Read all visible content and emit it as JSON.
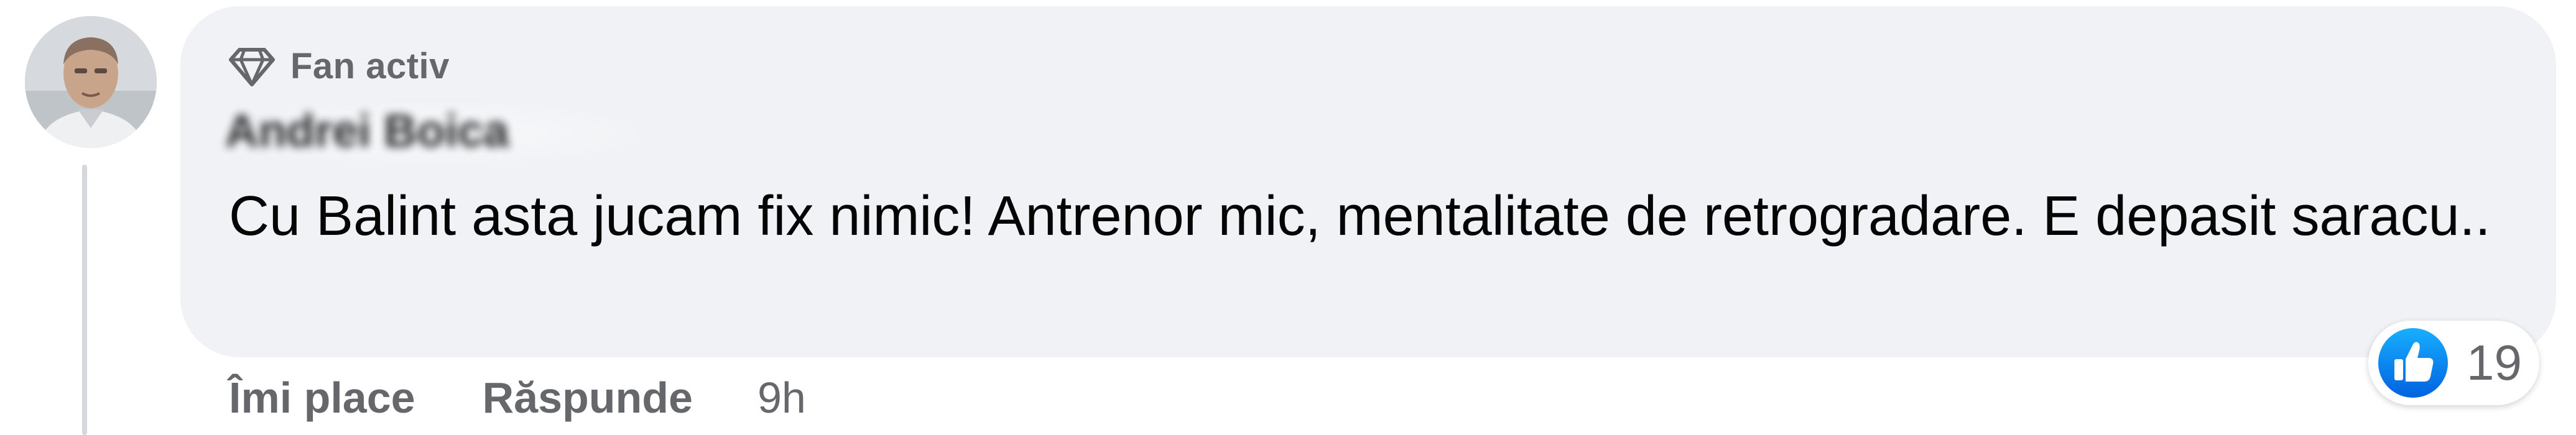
{
  "comment": {
    "badge_label": "Fan activ",
    "author_name": "Andrei Boica",
    "text": "Cu Balint asta jucam fix nimic! Antrenor mic, mentalitate de retrogradare. E depasit saracu..",
    "actions": {
      "like_label": "Îmi place",
      "reply_label": "Răspunde"
    },
    "timestamp": "9h",
    "reactions": {
      "icon": "like-thumb-icon",
      "count": "19"
    }
  },
  "colors": {
    "bubble_bg": "#f0f2f5",
    "secondary_text": "#65676b",
    "primary_text": "#050505",
    "like_blue": "#1877f2"
  }
}
